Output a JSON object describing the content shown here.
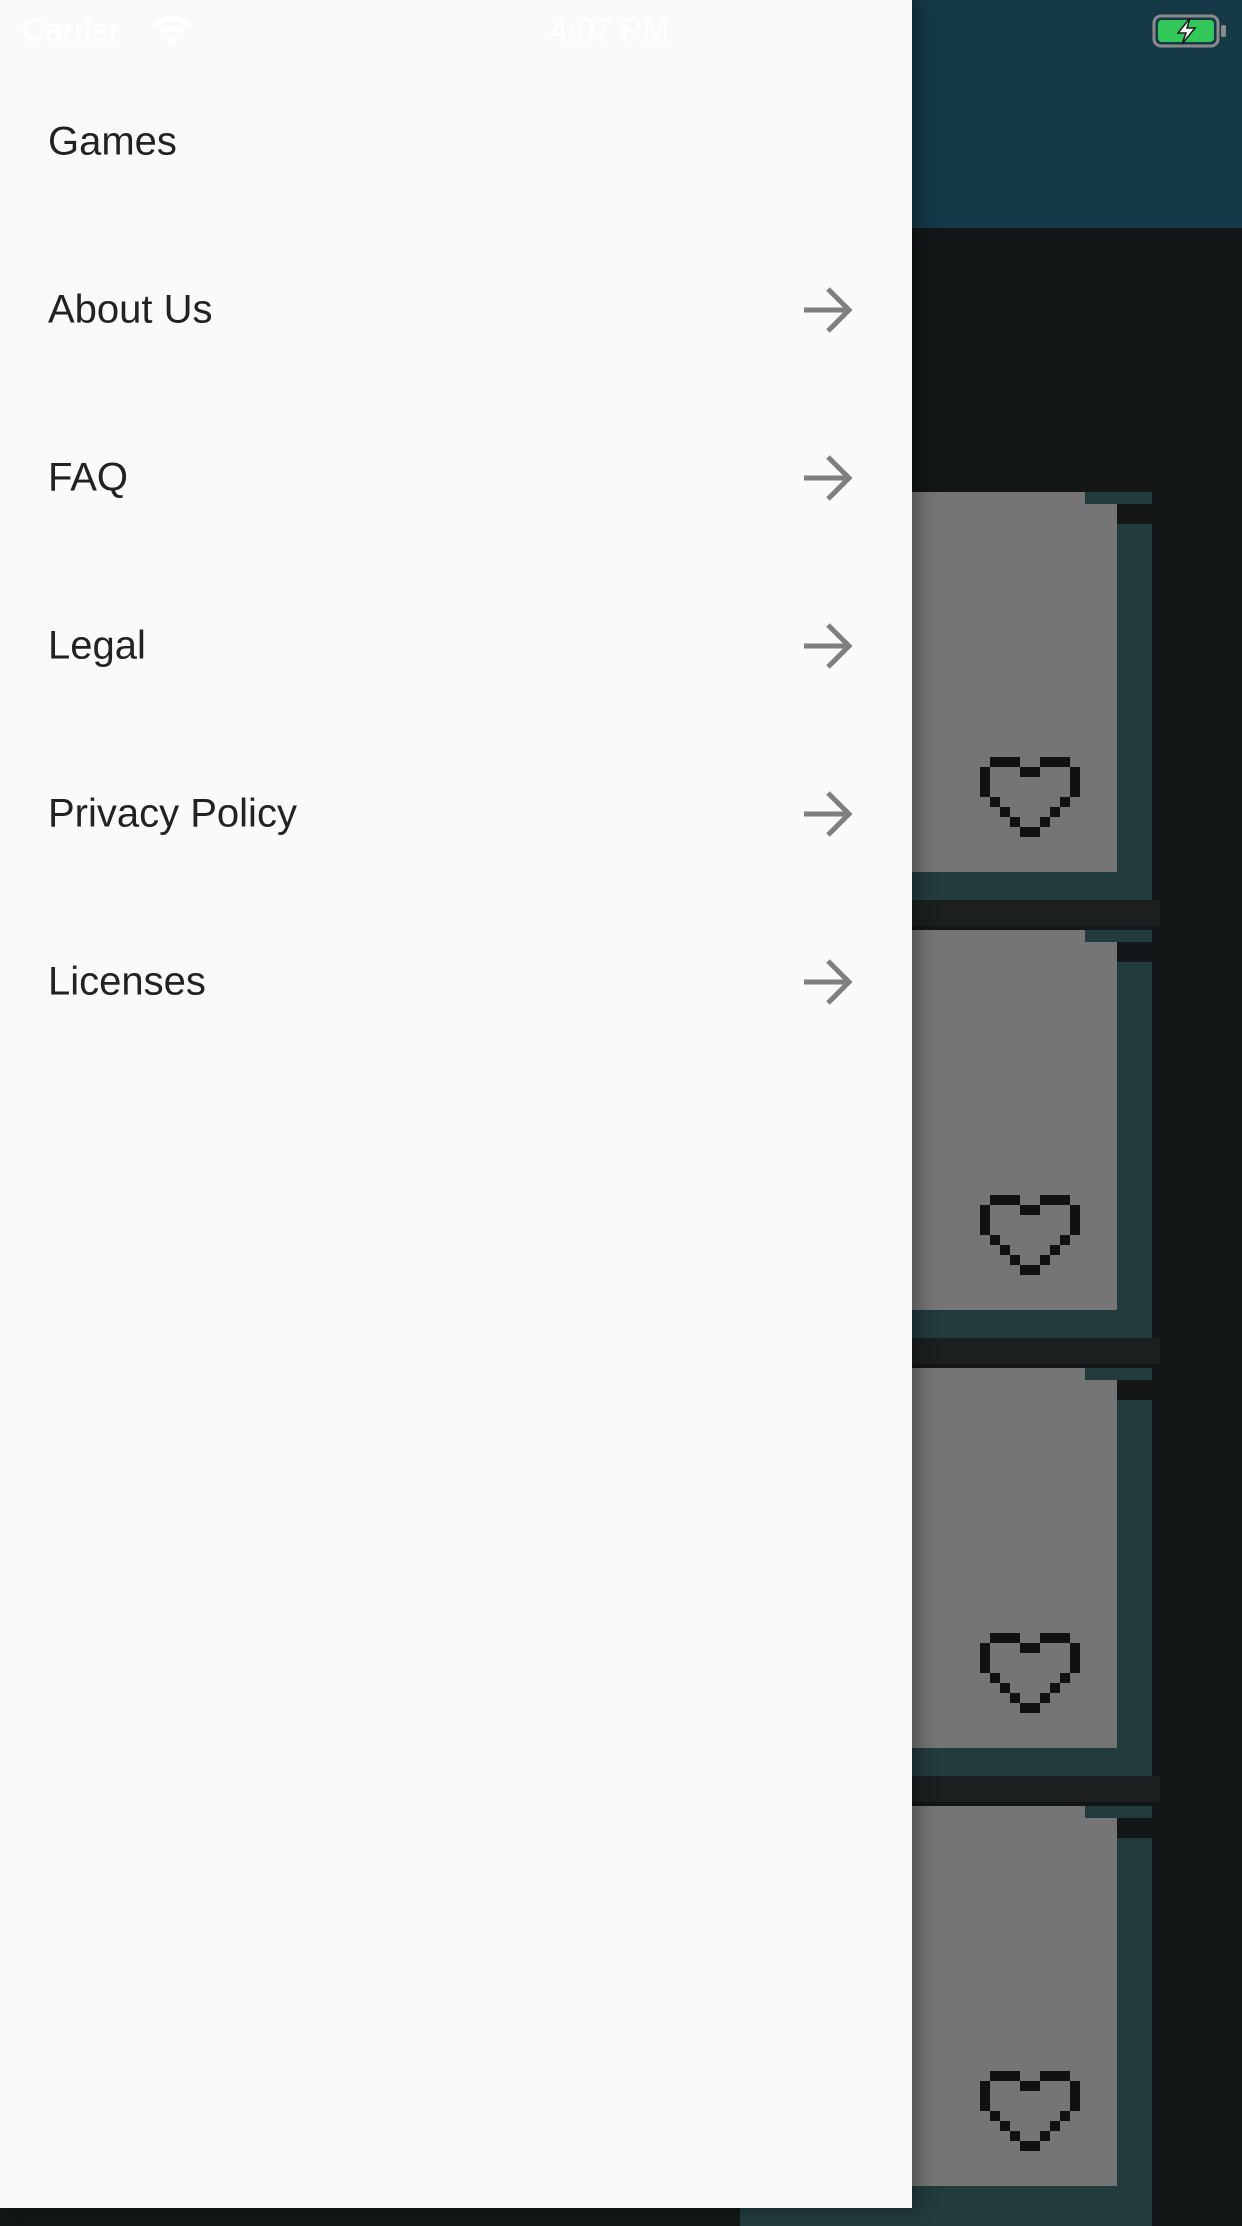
{
  "status_bar": {
    "carrier": "Carrier",
    "time": "4:07 PM",
    "wifi_icon": "wifi-icon",
    "battery_icon": "battery-charging-icon",
    "battery_color": "#34c759"
  },
  "drawer": {
    "background": "#fafafa",
    "items": [
      {
        "label": "Games",
        "has_arrow": false
      },
      {
        "label": "About Us",
        "has_arrow": true
      },
      {
        "label": "FAQ",
        "has_arrow": true
      },
      {
        "label": "Legal",
        "has_arrow": true
      },
      {
        "label": "Privacy Policy",
        "has_arrow": true
      },
      {
        "label": "Licenses",
        "has_arrow": true
      }
    ],
    "arrow_icon": "arrow-right-icon",
    "arrow_color": "#7f7f7f"
  },
  "background_app": {
    "header_color": "#153947",
    "content_color": "#131718",
    "card_color": "#757575",
    "card_shadow_color": "#223b3d",
    "card_icon": "pixel-heart-icon",
    "card_count": 4
  }
}
